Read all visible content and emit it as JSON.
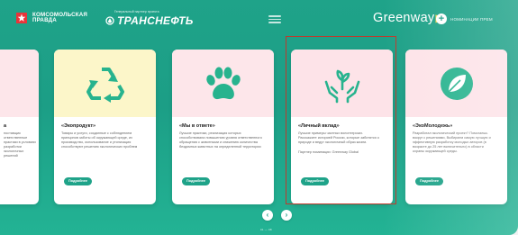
{
  "header": {
    "kp_line1": "КОМСОМОЛЬСКАЯ",
    "kp_line2": "ПРАВДА",
    "partner_caption": "Генеральный партнер проекта",
    "sponsor": "ТРАНСНЕФТЬ",
    "brand": "Greenway",
    "nominations_label": "НОМИНАЦИИ ПРЕМ"
  },
  "cards": [
    {
      "title": "а",
      "desc": "поставщик ответственные практики в условиях разработки экологичных решений"
    },
    {
      "title": "«Экопродукт»",
      "desc": "Товары и услуги, созданные с соблюдением принципов заботы об окружающей среде, их производство, использование и утилизация способствуют решению экологических проблем",
      "more": "Подробнее"
    },
    {
      "title": "«Мы в ответе»",
      "desc": "Лучшие практики, реализация которых способствовала повышению уровня ответственного обращения с животными и снижению количества бездомных животных на определенной территории",
      "more": "Подробнее"
    },
    {
      "title": "«Личный вклад»",
      "desc": "Лучшие примеры частных волонтерских. Расскажите историей России, которые заботятся о природе и ведут экологичный образ жизни.",
      "partner": "Партнер номинации: Greenway Global",
      "more": "Подробнее"
    },
    {
      "title": "«ЭкоМолодежь»",
      "desc": "Разработал экологический проект? Помогаешь вокруг с решениями, Выбираем самую лучшую и эффективную разработку молодых авторов (в возрасте до 25 лет включительно) в области охраны окружающей среды.",
      "more": "Подробнее"
    }
  ],
  "pager": "01 — 08",
  "colors": {
    "accent": "#1fa389",
    "highlight": "#c0392b",
    "band_yellow": "#fcf6c9",
    "band_pink": "#fde6ea"
  }
}
